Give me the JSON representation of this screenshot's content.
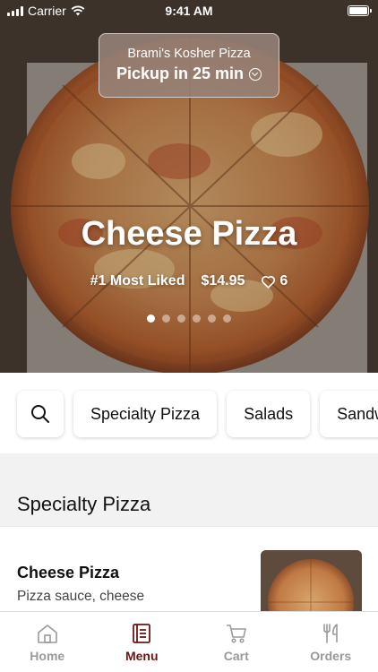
{
  "status": {
    "carrier": "Carrier",
    "time": "9:41 AM"
  },
  "store": {
    "name": "Brami's Kosher Pizza",
    "pickup": "Pickup in 25 min"
  },
  "hero": {
    "title": "Cheese Pizza",
    "rank": "#1 Most Liked",
    "price": "$14.95",
    "likes": "6",
    "carousel_pages": 6,
    "active_page": 1
  },
  "categories": [
    {
      "label": "Specialty Pizza"
    },
    {
      "label": "Salads"
    },
    {
      "label": "Sandwiches"
    }
  ],
  "section": {
    "title": "Specialty Pizza",
    "items": [
      {
        "name": "Cheese Pizza",
        "description": "Pizza sauce, cheese"
      }
    ]
  },
  "tabs": [
    {
      "label": "Home",
      "icon": "home-icon",
      "active": false
    },
    {
      "label": "Menu",
      "icon": "menu-icon",
      "active": true
    },
    {
      "label": "Cart",
      "icon": "cart-icon",
      "active": false
    },
    {
      "label": "Orders",
      "icon": "utensils-icon",
      "active": false
    }
  ],
  "colors": {
    "accent": "#6b1616",
    "inactive_tab": "#9a9a9a",
    "pill_bg": "#968278"
  }
}
